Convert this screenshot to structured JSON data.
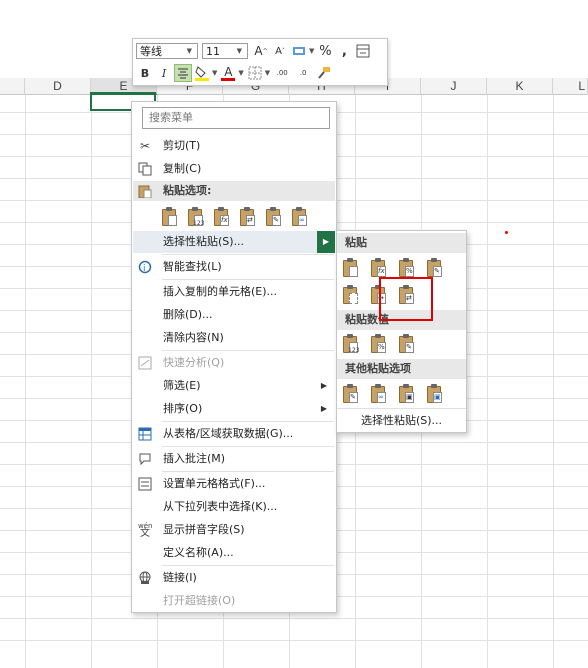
{
  "toolbar": {
    "font_name": "等线",
    "font_size": "11",
    "grow_font": "A",
    "shrink_font": "A",
    "percent": "%",
    "comma": ",",
    "bold": "B",
    "italic": "I",
    "font_color_letter": "A",
    "inc_decimal": ".00",
    "dec_decimal": ".0"
  },
  "columns": [
    "D",
    "E",
    "F",
    "G",
    "H",
    "I",
    "J",
    "K",
    "L"
  ],
  "menu": {
    "search_placeholder": "搜索菜单",
    "cut": "剪切(T)",
    "copy": "复制(C)",
    "paste_options": "粘贴选项:",
    "paste_special": "选择性粘贴(S)...",
    "smart_lookup": "智能查找(L)",
    "insert_copied": "插入复制的单元格(E)...",
    "delete": "删除(D)...",
    "clear_contents": "清除内容(N)",
    "quick_analysis": "快速分析(Q)",
    "filter": "筛选(E)",
    "sort": "排序(O)",
    "get_data": "从表格/区域获取数据(G)...",
    "insert_comment": "插入批注(M)",
    "format_cells": "设置单元格格式(F)...",
    "pick_from_list": "从下拉列表中选择(K)...",
    "phonetic": "显示拼音字段(S)",
    "define_name": "定义名称(A)...",
    "link": "链接(I)",
    "open_hyperlink": "打开超链接(O)"
  },
  "submenu": {
    "paste_header": "粘贴",
    "paste_values_header": "粘贴数值",
    "other_paste_header": "其他粘贴选项",
    "paste_special": "选择性粘贴(S)..."
  },
  "icon_labels": {
    "numbers": "123",
    "formula": "fx",
    "percent": "%"
  },
  "colors": {
    "accent": "#217346",
    "highlight_box": "#e00000"
  }
}
